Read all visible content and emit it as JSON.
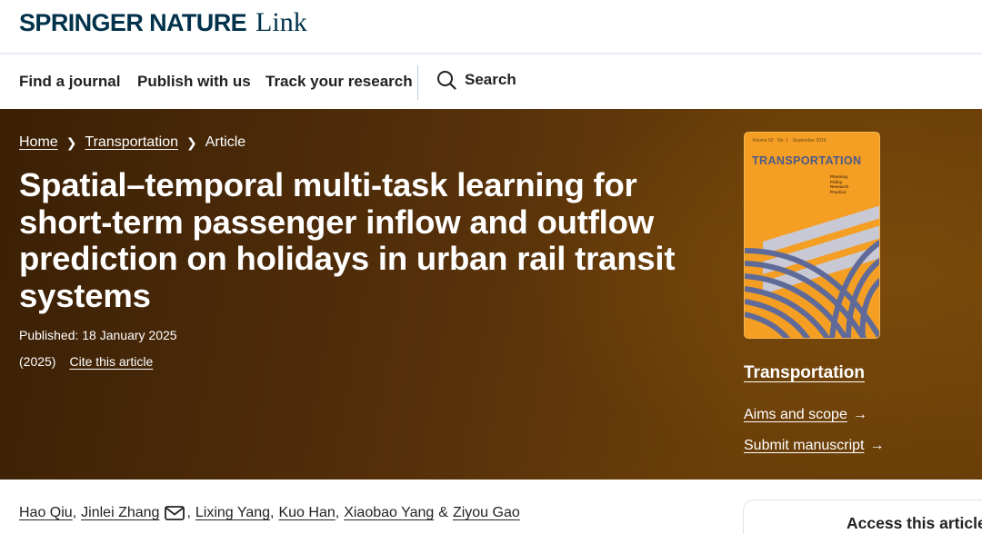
{
  "brand": {
    "name_bold": "SPRINGER NATURE",
    "name_light": "Link"
  },
  "nav": {
    "items": [
      "Find a journal",
      "Publish with us",
      "Track your research"
    ],
    "search_label": "Search"
  },
  "breadcrumb": {
    "home": "Home",
    "journal": "Transportation",
    "current": "Article"
  },
  "article": {
    "title": "Spatial–temporal multi-task learning for short-term passenger inflow and outflow prediction on holidays in urban rail transit systems",
    "published": "Published: 18 January 2025",
    "year": "(2025)",
    "cite_label": "Cite this article"
  },
  "journal": {
    "cover_meta": "Volume 52 · No. 1 · September 2019",
    "cover_title": "TRANSPORTATION",
    "cover_subtitle": [
      "Planning",
      "Policy",
      "Research",
      "Practice"
    ],
    "name": "Transportation",
    "aims_label": "Aims and scope",
    "submit_label": "Submit manuscript",
    "arrow": "→"
  },
  "authors": [
    "Hao Qiu",
    "Jinlei Zhang",
    "Lixing Yang",
    "Kuo Han",
    "Xiaobao Yang",
    "Ziyou Gao"
  ],
  "authors_conjunction": "&",
  "access": {
    "title": "Access this article"
  },
  "colors": {
    "brand_navy": "#01324b",
    "hero_brown": "#55300a",
    "cover_orange": "#f49e23",
    "cover_blue": "#4b5a8a"
  }
}
